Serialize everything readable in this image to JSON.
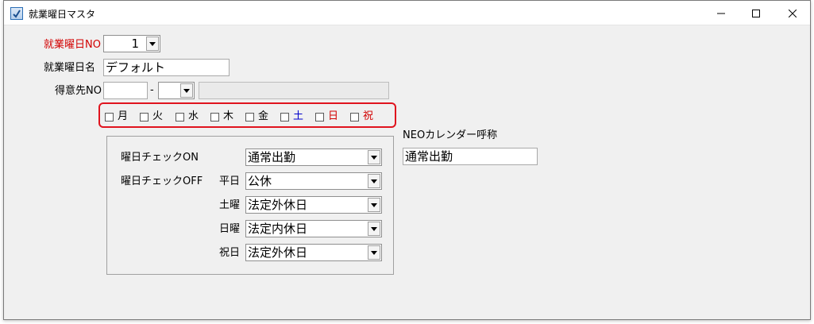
{
  "window": {
    "title": "就業曜日マスタ"
  },
  "form": {
    "no_label": "就業曜日NO",
    "no_value": "1",
    "name_label": "就業曜日名",
    "name_value": "デフォルト",
    "customer_label": "得意先NO",
    "customer_dash": "-",
    "customer_value1": "",
    "customer_value2": "",
    "customer_name": ""
  },
  "weekdays": [
    {
      "label": "月",
      "checked": false,
      "color": "#000000"
    },
    {
      "label": "火",
      "checked": false,
      "color": "#000000"
    },
    {
      "label": "水",
      "checked": false,
      "color": "#000000"
    },
    {
      "label": "木",
      "checked": false,
      "color": "#000000"
    },
    {
      "label": "金",
      "checked": false,
      "color": "#000000"
    },
    {
      "label": "土",
      "checked": false,
      "color": "#0000cc"
    },
    {
      "label": "日",
      "checked": false,
      "color": "#d20000"
    },
    {
      "label": "祝",
      "checked": false,
      "color": "#d20000"
    }
  ],
  "check": {
    "on_label": "曜日チェックON",
    "on_value": "通常出勤",
    "off_label": "曜日チェックOFF",
    "weekday_label": "平日",
    "weekday_value": "公休",
    "saturday_label": "土曜",
    "saturday_value": "法定外休日",
    "sunday_label": "日曜",
    "sunday_value": "法定内休日",
    "holiday_label": "祝日",
    "holiday_value": "法定外休日"
  },
  "neo": {
    "label": "NEOカレンダー呼称",
    "value": "通常出勤"
  },
  "colors": {
    "highlight_border": "#e0141e",
    "required_label": "#d20000"
  }
}
